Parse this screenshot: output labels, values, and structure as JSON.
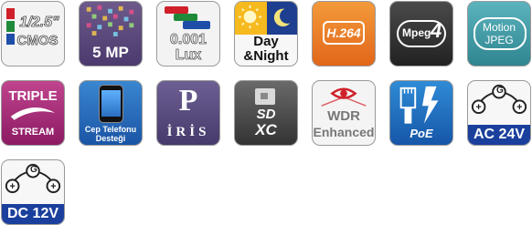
{
  "icons": [
    {
      "id": "cmos",
      "line1": "1/2.5\"",
      "line2": "CMOS"
    },
    {
      "id": "megapixel",
      "label": "5 MP"
    },
    {
      "id": "low-lux",
      "line1": "0.001",
      "line2": "Lux"
    },
    {
      "id": "day-night",
      "line1": "Day",
      "line2": "&Night"
    },
    {
      "id": "h264",
      "label": "H.264"
    },
    {
      "id": "mpeg4",
      "label": "Mpeg",
      "label2": "4"
    },
    {
      "id": "motion-jpeg",
      "line1": "Motion",
      "line2": "JPEG"
    },
    {
      "id": "triple-stream",
      "line1": "TRIPLE",
      "line2": "STREAM"
    },
    {
      "id": "mobile-support",
      "line1": "Cep Telefonu",
      "line2": "Desteği"
    },
    {
      "id": "iris",
      "letter": "P",
      "label": "İRİS"
    },
    {
      "id": "sdxc",
      "line1": "SD",
      "line2": "XC"
    },
    {
      "id": "wdr",
      "line1": "WDR",
      "line2": "Enhanced"
    },
    {
      "id": "poe",
      "label": "PoE"
    },
    {
      "id": "ac24v",
      "label": "AC 24V",
      "g": "G"
    },
    {
      "id": "dc12v",
      "label": "DC 12V",
      "g": "G"
    }
  ],
  "colors": {
    "red": "#d0202a",
    "green": "#1f8a3a",
    "blue": "#1e4ea8",
    "purple": "#4b3a6e",
    "orange": "#e9761d",
    "dark": "#2e2e2e",
    "teal": "#3f9aa5",
    "magenta": "#b1287b",
    "navy": "#1a3f9c"
  }
}
